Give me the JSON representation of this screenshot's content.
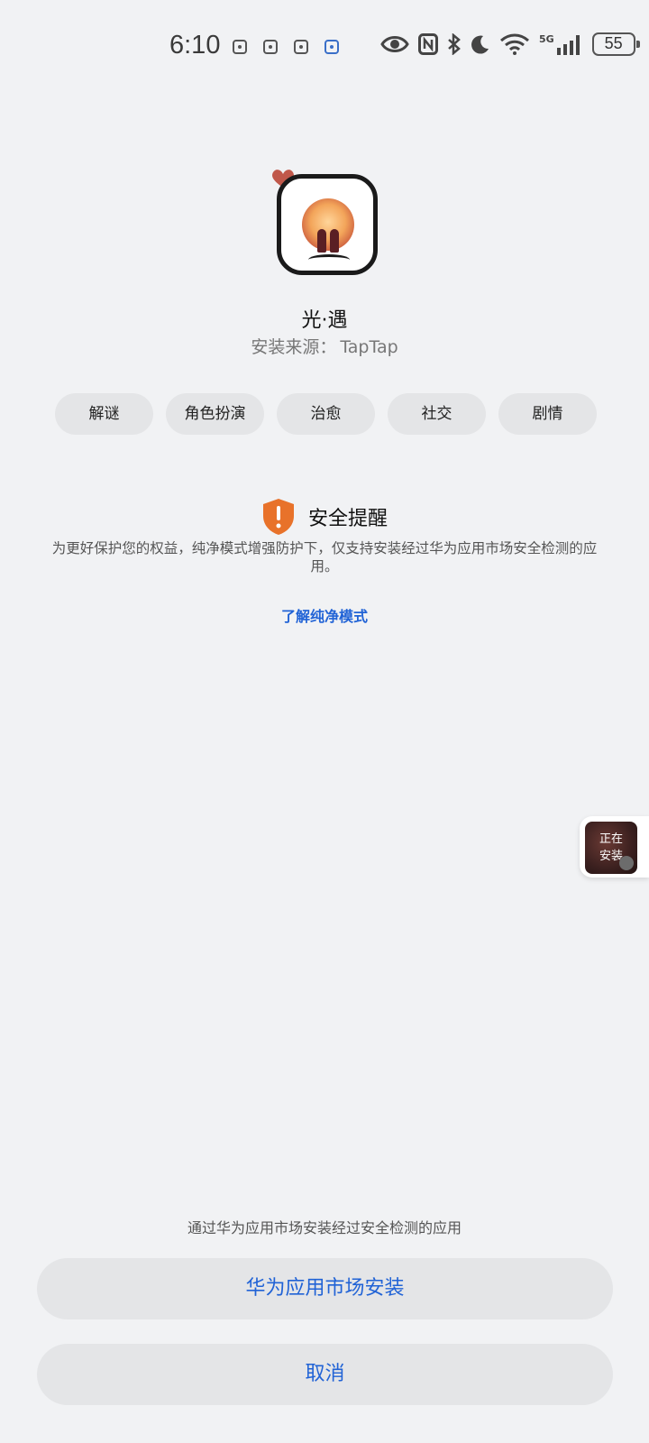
{
  "status_bar": {
    "time": "6:10",
    "battery": "55",
    "network": "5G",
    "notification_icons": [
      "app-notification-icon",
      "app-notification-icon",
      "app-notification-icon",
      "app-notification-icon"
    ],
    "system_icons": [
      "eye-icon",
      "nfc-icon",
      "bluetooth-icon",
      "moon-icon",
      "wifi-icon",
      "signal-icon",
      "battery-icon"
    ]
  },
  "app": {
    "name": "光·遇",
    "source_label": "安装来源：",
    "source_value": "TapTap",
    "tags": [
      "解谜",
      "角色扮演",
      "治愈",
      "社交",
      "剧情"
    ]
  },
  "security": {
    "title": "安全提醒",
    "text": "为更好保护您的权益，纯净模式增强防护下，仅支持安装经过华为应用市场安全检测的应用。",
    "link": "了解纯净模式"
  },
  "floating_widget": {
    "line1": "正在",
    "line2": "安装"
  },
  "bottom": {
    "note": "通过华为应用市场安装经过安全检测的应用",
    "primary_button": "华为应用市场安装",
    "cancel_button": "取消"
  },
  "colors": {
    "background": "#f1f2f4",
    "accent": "#2163d6",
    "warning": "#e8722a",
    "button_bg": "#e4e5e7"
  }
}
